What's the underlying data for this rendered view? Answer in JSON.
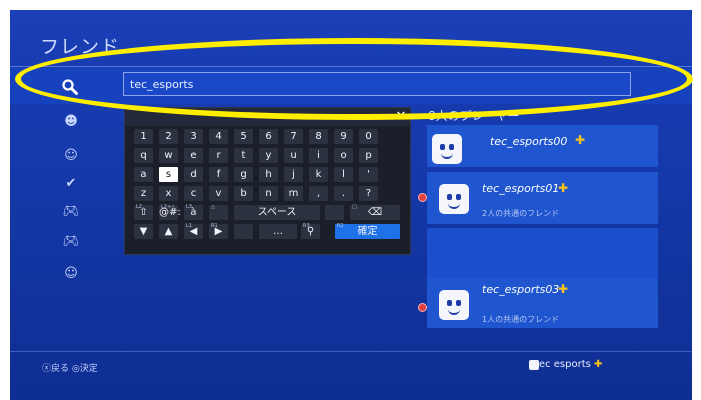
{
  "header": {
    "title": "フレンド"
  },
  "search": {
    "value": "tec_esports"
  },
  "sidebar": {
    "icons": [
      "friends-icon",
      "friend-request-icon",
      "favorite-player-icon",
      "gamepad-icon",
      "gamepad-icon",
      "add-friend-icon"
    ]
  },
  "keyboard": {
    "close": "✕",
    "row1": [
      "1",
      "2",
      "3",
      "4",
      "5",
      "6",
      "7",
      "8",
      "9",
      "0"
    ],
    "row2": [
      "q",
      "w",
      "e",
      "r",
      "t",
      "y",
      "u",
      "i",
      "o",
      "p"
    ],
    "row3": [
      "a",
      "s",
      "d",
      "f",
      "g",
      "h",
      "j",
      "k",
      "l",
      "'"
    ],
    "row4": [
      "z",
      "x",
      "c",
      "v",
      "b",
      "n",
      "m",
      ",",
      ".",
      "?"
    ],
    "row5": {
      "shift_hint": "L2",
      "shift": "⇧",
      "sym_hint": "L2+△",
      "sym": "@#:",
      "accent_hint": "L3",
      "accent": "à",
      "space_hint": "△",
      "space": "スペース",
      "bksp_hint": "□",
      "bksp": "⌫"
    },
    "row6": {
      "down": "▼",
      "up": "▲",
      "left_hint": "L1",
      "left": "◀",
      "right_hint": "R1",
      "right": "▶",
      "dots": "…",
      "mic_hint": "R3",
      "mic": "⚲",
      "confirm_hint": "R2",
      "confirm": "確定"
    }
  },
  "list": {
    "header": "8人のプレーヤー",
    "players": [
      {
        "name": "tec_esports00",
        "mutual": ""
      },
      {
        "name": "tec_esports01",
        "mutual": "2人の共通のフレンド"
      },
      {
        "name": "tec_esports03",
        "mutual": "1人の共通のフレンド"
      }
    ]
  },
  "footer": {
    "back": "ⓧ戻る  ◎決定",
    "user": "tec esports"
  },
  "colors": {
    "accent_plus": "#ffc21a",
    "highlight": "#ffee00"
  }
}
